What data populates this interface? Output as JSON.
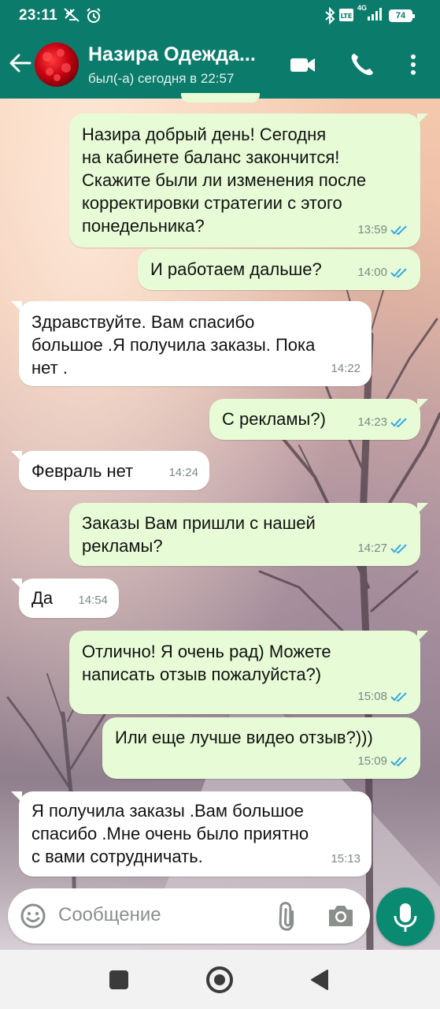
{
  "status_bar": {
    "time": "23:11",
    "network": "4G",
    "battery": "74"
  },
  "header": {
    "contact_name": "Назира Одежда...",
    "last_seen": "был(-а) сегодня в 22:57"
  },
  "messages": [
    {
      "dir": "out",
      "text": "Назира добрый день! Сегодня\nна кабинете баланс закончится!\nСкажите были ли изменения после\nкорректировки стратегии с этого\nпонедельника?",
      "time": "13:59"
    },
    {
      "dir": "out",
      "text": "И работаем дальше?",
      "time": "14:00"
    },
    {
      "dir": "in",
      "text": "Здравствуйте. Вам спасибо\nбольшое .Я получила заказы. Пока\nнет .",
      "time": "14:22"
    },
    {
      "dir": "out",
      "text": "С рекламы?)",
      "time": "14:23"
    },
    {
      "dir": "in",
      "text": "Февраль нет",
      "time": "14:24"
    },
    {
      "dir": "out",
      "text": "Заказы Вам пришли с нашей\nрекламы?",
      "time": "14:27"
    },
    {
      "dir": "in",
      "text": "Да",
      "time": "14:54"
    },
    {
      "dir": "out",
      "text": "Отлично! Я очень рад) Можете\nнаписать отзыв пожалуйста?)",
      "time": "15:08"
    },
    {
      "dir": "out",
      "text": "Или еще лучше видео отзыв?)))",
      "time": "15:09"
    },
    {
      "dir": "in",
      "text": "Я получила заказы .Вам большое\nспасибо .Мне очень было приятно\nс вами сотрудничать.",
      "time": "15:13"
    }
  ],
  "composer": {
    "placeholder": "Сообщение"
  },
  "colors": {
    "header": "#0b7b6b",
    "outgoing_bubble": "#e7fcd6",
    "incoming_bubble": "#ffffff",
    "read_ticks": "#34a6e5",
    "mic_button": "#0b8a72"
  },
  "icons": {
    "back": "arrow-left",
    "video": "video-camera",
    "call": "phone",
    "menu": "three-dots-vertical",
    "emoji": "smiley",
    "attach": "paperclip",
    "camera": "camera",
    "mic": "microphone",
    "nav_recents": "square",
    "nav_home": "circle",
    "nav_back": "triangle"
  }
}
